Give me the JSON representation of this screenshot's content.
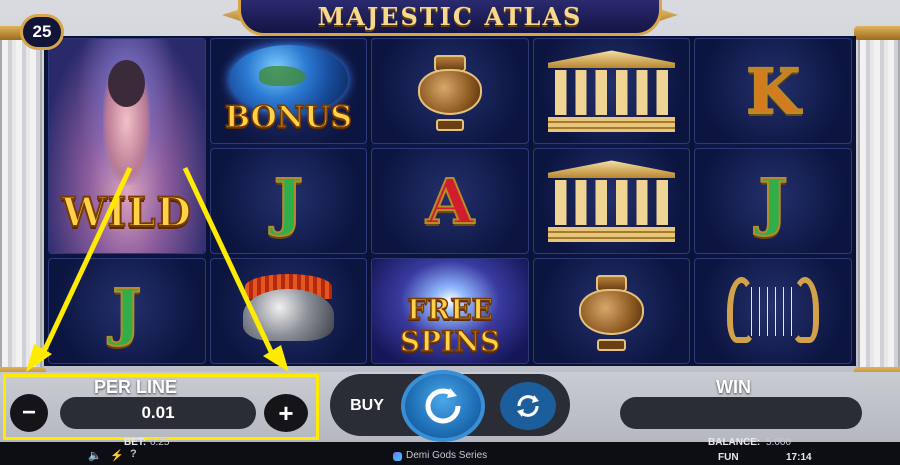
{
  "game": {
    "title": "MAJESTIC ATLAS",
    "lines": "25"
  },
  "reels": [
    {
      "symbols": [
        "WILD",
        "J"
      ]
    },
    {
      "symbols": [
        "BONUS",
        "J",
        "helmet"
      ]
    },
    {
      "symbols": [
        "vase",
        "A",
        "FREE SPINS"
      ]
    },
    {
      "symbols": [
        "temple",
        "temple",
        "vase"
      ]
    },
    {
      "symbols": [
        "K",
        "J",
        "lyre"
      ]
    }
  ],
  "symbol_text": {
    "wild": "WILD",
    "bonus": "BONUS",
    "J": "J",
    "A": "A",
    "K": "K",
    "free_spins_line1": "FREE",
    "free_spins_line2": "SPINS"
  },
  "controls": {
    "per_line_label": "PER LINE",
    "per_line_value": "0.01",
    "minus": "−",
    "plus": "+",
    "buy_label": "BUY",
    "win_label": "WIN",
    "win_value": ""
  },
  "status_bar": {
    "bet_label": "BET:",
    "bet_value": "0.25",
    "balance_label": "BALANCE:",
    "balance_value": "5.000",
    "series_name": "Demi Gods Series",
    "mode": "FUN",
    "time": "17:14"
  },
  "colors": {
    "accent_gold": "#d7a64a",
    "annotation_yellow": "#ffeb00",
    "spin_blue": "#1e6fb6"
  },
  "icons": {
    "sound": "speaker-icon",
    "turbo": "lightning-icon",
    "help": "question-icon",
    "spin": "spin-arrow-icon",
    "autoplay": "autoplay-icon"
  }
}
